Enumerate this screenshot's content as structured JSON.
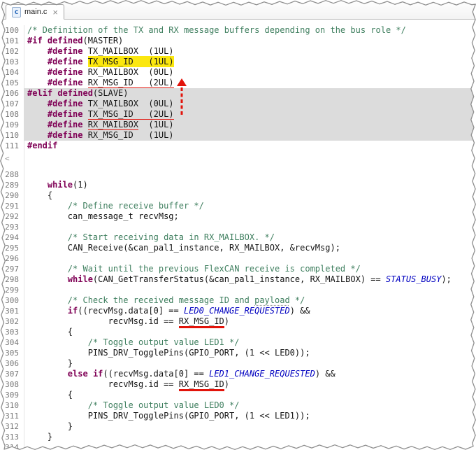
{
  "tab": {
    "label": "main.c",
    "icon_letter": "c",
    "close_glyph": "×"
  },
  "colors": {
    "keyword": "#7f0055",
    "comment": "#3f7f5f",
    "plain": "#141414",
    "enum-const": "#0000c0",
    "line-number": "#787878",
    "highlight-yellow": "#fbe70f",
    "annotation-red": "#e2140b",
    "shade-gray": "#dcdcdc",
    "torn-edge": "#8f8f8f"
  },
  "editor": {
    "fold_marker": "<",
    "sections": [
      {
        "start": 100,
        "gap_after": true,
        "lines": [
          {
            "t": [
              [
                "c",
                "/* Definition of the TX and RX message buffers depending on the bus role */"
              ]
            ]
          },
          {
            "t": [
              [
                "k",
                "#if defined"
              ],
              [
                "p",
                "(MASTER)"
              ]
            ]
          },
          {
            "t": [
              [
                "p",
                "    "
              ],
              [
                "k",
                "#define"
              ],
              [
                "p",
                " TX_MAILBOX  (1UL)"
              ]
            ]
          },
          {
            "t": [
              [
                "p",
                "    "
              ],
              [
                "k",
                "#define"
              ],
              [
                "p",
                " "
              ],
              [
                "hl",
                "TX_MSG_ID   (1UL)"
              ]
            ]
          },
          {
            "t": [
              [
                "p",
                "    "
              ],
              [
                "k",
                "#define"
              ],
              [
                "p",
                " RX_MAILBOX  (0UL)"
              ]
            ]
          },
          {
            "t": [
              [
                "p",
                "    "
              ],
              [
                "k",
                "#define"
              ],
              [
                "p",
                " "
              ],
              [
                "ul",
                "RX_MSG_ID   (2UL)"
              ]
            ]
          },
          {
            "shaded": true,
            "t": [
              [
                "k",
                "#elif defined"
              ],
              [
                "p",
                "(SLAVE)"
              ]
            ]
          },
          {
            "shaded": true,
            "t": [
              [
                "p",
                "    "
              ],
              [
                "k",
                "#define"
              ],
              [
                "p",
                " TX_MAILBOX  (0UL)"
              ]
            ]
          },
          {
            "shaded": true,
            "t": [
              [
                "p",
                "    "
              ],
              [
                "k",
                "#define"
              ],
              [
                "p",
                " "
              ],
              [
                "ul",
                "TX_MSG_ID   (2UL)"
              ]
            ]
          },
          {
            "shaded": true,
            "t": [
              [
                "p",
                "    "
              ],
              [
                "k",
                "#define"
              ],
              [
                "p",
                " "
              ],
              [
                "ul",
                "RX_MAILBOX"
              ],
              [
                "p",
                "  (1UL)"
              ]
            ]
          },
          {
            "shaded": true,
            "t": [
              [
                "p",
                "    "
              ],
              [
                "k",
                "#define"
              ],
              [
                "p",
                " RX_MSG_ID   (1UL)"
              ]
            ]
          },
          {
            "t": [
              [
                "k",
                "#endif"
              ]
            ]
          }
        ]
      },
      {
        "start": 288,
        "gap_after": false,
        "lines": [
          {
            "t": []
          },
          {
            "t": [
              [
                "p",
                "    "
              ],
              [
                "k",
                "while"
              ],
              [
                "p",
                "(1)"
              ]
            ]
          },
          {
            "t": [
              [
                "p",
                "    {"
              ]
            ]
          },
          {
            "t": [
              [
                "p",
                "        "
              ],
              [
                "c",
                "/* Define receive buffer */"
              ]
            ]
          },
          {
            "t": [
              [
                "p",
                "        can_message_t recvMsg;"
              ]
            ]
          },
          {
            "t": []
          },
          {
            "t": [
              [
                "p",
                "        "
              ],
              [
                "c",
                "/* Start receiving data in RX_MAILBOX. */"
              ]
            ]
          },
          {
            "t": [
              [
                "p",
                "        CAN_Receive(&can_pal1_instance, RX_MAILBOX, &recvMsg);"
              ]
            ]
          },
          {
            "t": []
          },
          {
            "t": [
              [
                "p",
                "        "
              ],
              [
                "c",
                "/* Wait until the previous FlexCAN receive is completed */"
              ]
            ]
          },
          {
            "t": [
              [
                "p",
                "        "
              ],
              [
                "k",
                "while"
              ],
              [
                "p",
                "(CAN_GetTransferStatus(&can_pal1_instance, RX_MAILBOX) == "
              ],
              [
                "e",
                "STATUS_BUSY"
              ],
              [
                "p",
                ");"
              ]
            ]
          },
          {
            "t": []
          },
          {
            "t": [
              [
                "p",
                "        "
              ],
              [
                "c",
                "/* Check the received message ID and "
              ],
              [
                "c sp",
                "payload"
              ],
              [
                "c",
                " */"
              ]
            ]
          },
          {
            "t": [
              [
                "p",
                "        "
              ],
              [
                "k",
                "if"
              ],
              [
                "p",
                "((recvMsg.data[0] == "
              ],
              [
                "e",
                "LED0_CHANGE_REQUESTED"
              ],
              [
                "p",
                ") &&"
              ]
            ]
          },
          {
            "t": [
              [
                "p",
                "                recvMsg.id == "
              ],
              [
                "ul",
                "RX_MSG_ID"
              ],
              [
                "p",
                ")"
              ]
            ]
          },
          {
            "t": [
              [
                "p",
                "        {"
              ]
            ]
          },
          {
            "t": [
              [
                "p",
                "            "
              ],
              [
                "c",
                "/* Toggle output value LED1 */"
              ]
            ]
          },
          {
            "t": [
              [
                "p",
                "            PINS_DRV_TogglePins(GPIO_PORT, (1 << LED0));"
              ]
            ]
          },
          {
            "t": [
              [
                "p",
                "        }"
              ]
            ]
          },
          {
            "t": [
              [
                "p",
                "        "
              ],
              [
                "k",
                "else"
              ],
              [
                "p",
                " "
              ],
              [
                "k",
                "if"
              ],
              [
                "p",
                "((recvMsg.data[0] == "
              ],
              [
                "e",
                "LED1_CHANGE_REQUESTED"
              ],
              [
                "p",
                ") &&"
              ]
            ]
          },
          {
            "t": [
              [
                "p",
                "                recvMsg.id == "
              ],
              [
                "ul",
                "RX_MSG_ID"
              ],
              [
                "p",
                ")"
              ]
            ]
          },
          {
            "t": [
              [
                "p",
                "        {"
              ]
            ]
          },
          {
            "t": [
              [
                "p",
                "            "
              ],
              [
                "c",
                "/* Toggle output value LED0 */"
              ]
            ]
          },
          {
            "t": [
              [
                "p",
                "            PINS_DRV_TogglePins(GPIO_PORT, (1 << LED1));"
              ]
            ]
          },
          {
            "t": [
              [
                "p",
                "        }"
              ]
            ]
          },
          {
            "t": [
              [
                "p",
                "    }"
              ]
            ]
          },
          {
            "t": []
          }
        ]
      }
    ]
  },
  "annotations": {
    "arrow_note": "red dashed arrow pointing up from TX_MSG_ID (2UL) on line 108 to RX_MSG_ID (2UL) on line 105"
  }
}
